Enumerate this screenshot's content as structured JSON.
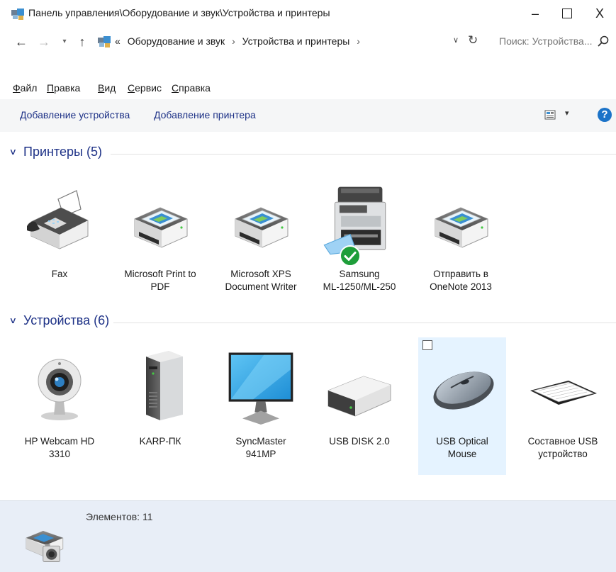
{
  "window": {
    "title": "Панель управления\\Оборудование и звук\\Устройства и принтеры",
    "minimize_glyph": "–",
    "close_glyph": "X"
  },
  "nav": {
    "back_glyph": "←",
    "forward_glyph": "→",
    "recent_glyph": "▾",
    "up_glyph": "↑"
  },
  "address": {
    "overflow": "«",
    "crumbs": [
      "Оборудование и звук",
      "Устройства и принтеры"
    ],
    "separator": "›",
    "dropdown_glyph": "∨",
    "refresh_glyph": "↻"
  },
  "search": {
    "placeholder": "Поиск: Устройства..."
  },
  "menu": {
    "items": [
      "Файл",
      "Правка",
      "Вид",
      "Сервис",
      "Справка"
    ]
  },
  "commands": {
    "add_device": "Добавление устройства",
    "add_printer": "Добавление принтера",
    "view_dropdown_glyph": "▾",
    "help_glyph": "?"
  },
  "groups": {
    "printers": {
      "title": "Принтеры (5)",
      "items": [
        {
          "label": "Fax",
          "icon": "fax-icon"
        },
        {
          "label": "Microsoft Print to\nPDF",
          "icon": "printer-icon"
        },
        {
          "label": "Microsoft XPS\nDocument Writer",
          "icon": "printer-icon"
        },
        {
          "label": "Samsung\nML-1250/ML-250",
          "icon": "mfp-printer-icon",
          "default": true
        },
        {
          "label": "Отправить в\nOneNote 2013",
          "icon": "printer-icon"
        }
      ]
    },
    "devices": {
      "title": "Устройства (6)",
      "items": [
        {
          "label": "HP Webcam HD\n3310",
          "icon": "webcam-icon"
        },
        {
          "label": "KARP-ПК",
          "icon": "computer-tower-icon"
        },
        {
          "label": "SyncMaster\n941MP",
          "icon": "monitor-icon"
        },
        {
          "label": "USB DISK 2.0",
          "icon": "usb-disk-icon"
        },
        {
          "label": "USB Optical\nMouse",
          "icon": "mouse-icon",
          "selected": true
        },
        {
          "label": "Составное USB\nустройство",
          "icon": "keyboard-icon"
        }
      ]
    }
  },
  "status": {
    "count": "Элементов: 11"
  },
  "colors": {
    "accent": "#1e3287",
    "selection": "#e5f3ff",
    "details_bg": "#e8eef7",
    "check_green": "#1e9e3a"
  }
}
